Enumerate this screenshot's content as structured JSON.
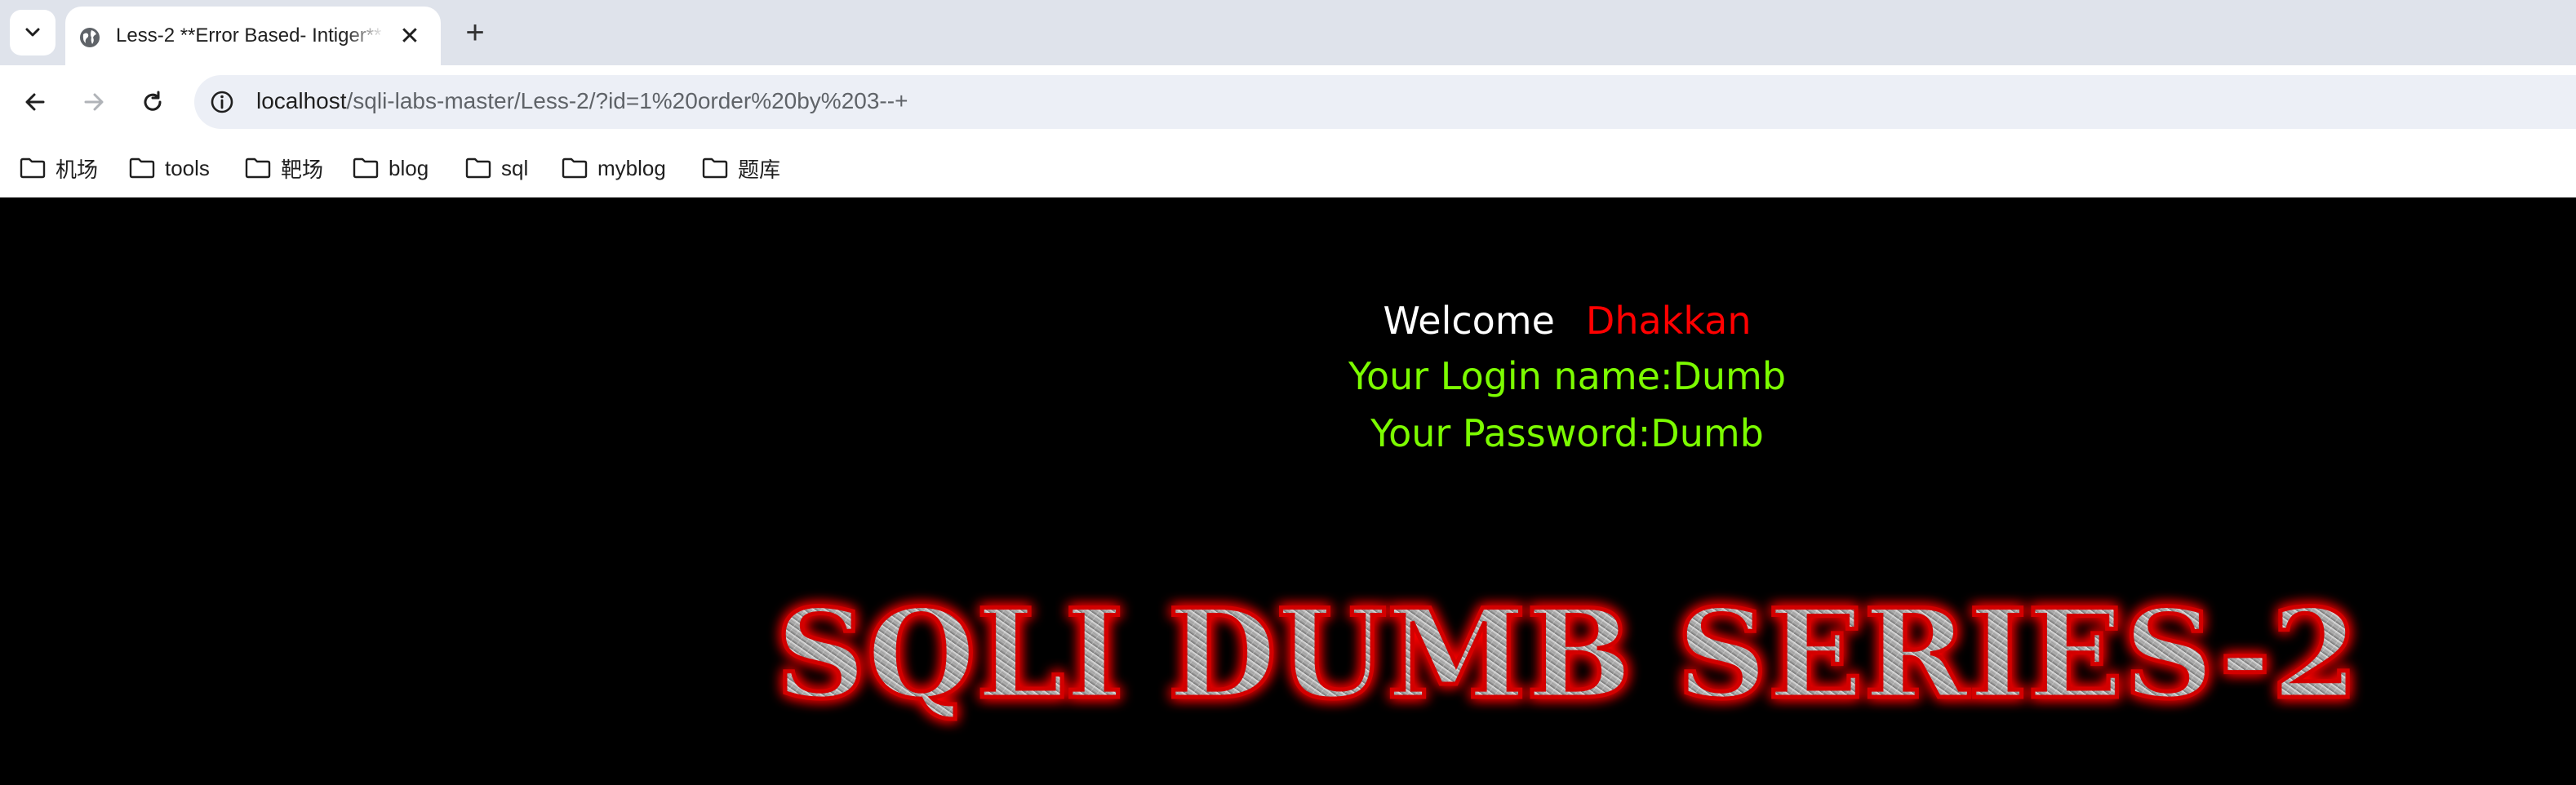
{
  "tab": {
    "title": "Less-2 **Error Based- Intiger**",
    "close_label": "✕",
    "new_tab_label": "+"
  },
  "address_bar": {
    "host": "localhost",
    "path": "/sqli-labs-master/Less-2/?id=1%20order%20by%203--+"
  },
  "bookmarks": [
    {
      "label": "机场"
    },
    {
      "label": "tools"
    },
    {
      "label": "靶场"
    },
    {
      "label": "blog"
    },
    {
      "label": "sql"
    },
    {
      "label": "myblog"
    },
    {
      "label": "题库"
    }
  ],
  "page": {
    "welcome_word": "Welcome",
    "welcome_name": "Dhakkan",
    "login_line": "Your Login name:Dumb",
    "password_line": "Your Password:Dumb",
    "banner_text": "SQLI DUMB SERIES-2"
  },
  "colors": {
    "page_background": "#000000",
    "welcome_name": "#ff0000",
    "result_text": "#7cfc00",
    "banner_glow": "#ff0000"
  }
}
